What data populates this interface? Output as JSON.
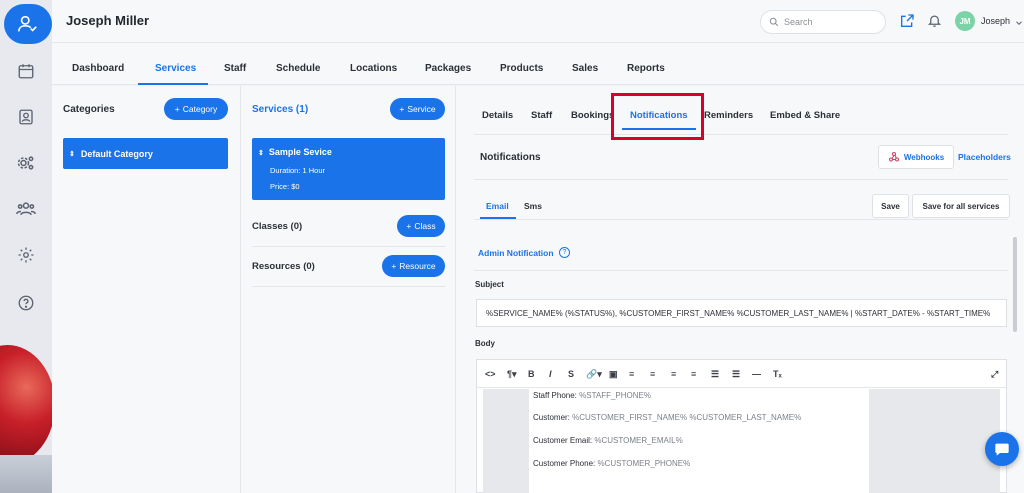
{
  "header": {
    "title": "Joseph Miller",
    "search_placeholder": "Search",
    "avatar_initials": "JM",
    "user_name": "Joseph"
  },
  "main_tabs": [
    "Dashboard",
    "Services",
    "Staff",
    "Schedule",
    "Locations",
    "Packages",
    "Products",
    "Sales",
    "Reports"
  ],
  "categories": {
    "title": "Categories",
    "add_label": "Category",
    "items": [
      "Default Category"
    ]
  },
  "services": {
    "title": "Services (1)",
    "add_label": "Service",
    "card": {
      "name": "Sample Sevice",
      "duration": "Duration: 1 Hour",
      "price": "Price: $0"
    },
    "classes_title": "Classes (0)",
    "classes_add": "Class",
    "resources_title": "Resources (0)",
    "resources_add": "Resource"
  },
  "detail_tabs": [
    "Details",
    "Staff",
    "Bookings",
    "Notifications",
    "Reminders",
    "Embed & Share"
  ],
  "notifications": {
    "title": "Notifications",
    "webhooks": "Webhooks",
    "placeholders": "Placeholders",
    "sub_tabs": [
      "Email",
      "Sms"
    ],
    "save": "Save",
    "save_all": "Save for all services",
    "admin_label": "Admin Notification",
    "subject_label": "Subject",
    "subject_value": "%SERVICE_NAME% (%STATUS%), %CUSTOMER_FIRST_NAME% %CUSTOMER_LAST_NAME% | %START_DATE% - %START_TIME%",
    "body_label": "Body",
    "body_lines": [
      {
        "label": "Staff Phone:",
        "value": "%STAFF_PHONE%"
      },
      {
        "label": "Customer:",
        "value": "%CUSTOMER_FIRST_NAME% %CUSTOMER_LAST_NAME%"
      },
      {
        "label": "Customer Email:",
        "value": "%CUSTOMER_EMAIL%"
      },
      {
        "label": "Customer Phone:",
        "value": "%CUSTOMER_PHONE%"
      }
    ]
  },
  "colors": {
    "accent": "#1a73e8",
    "highlight": "#d6002a"
  }
}
